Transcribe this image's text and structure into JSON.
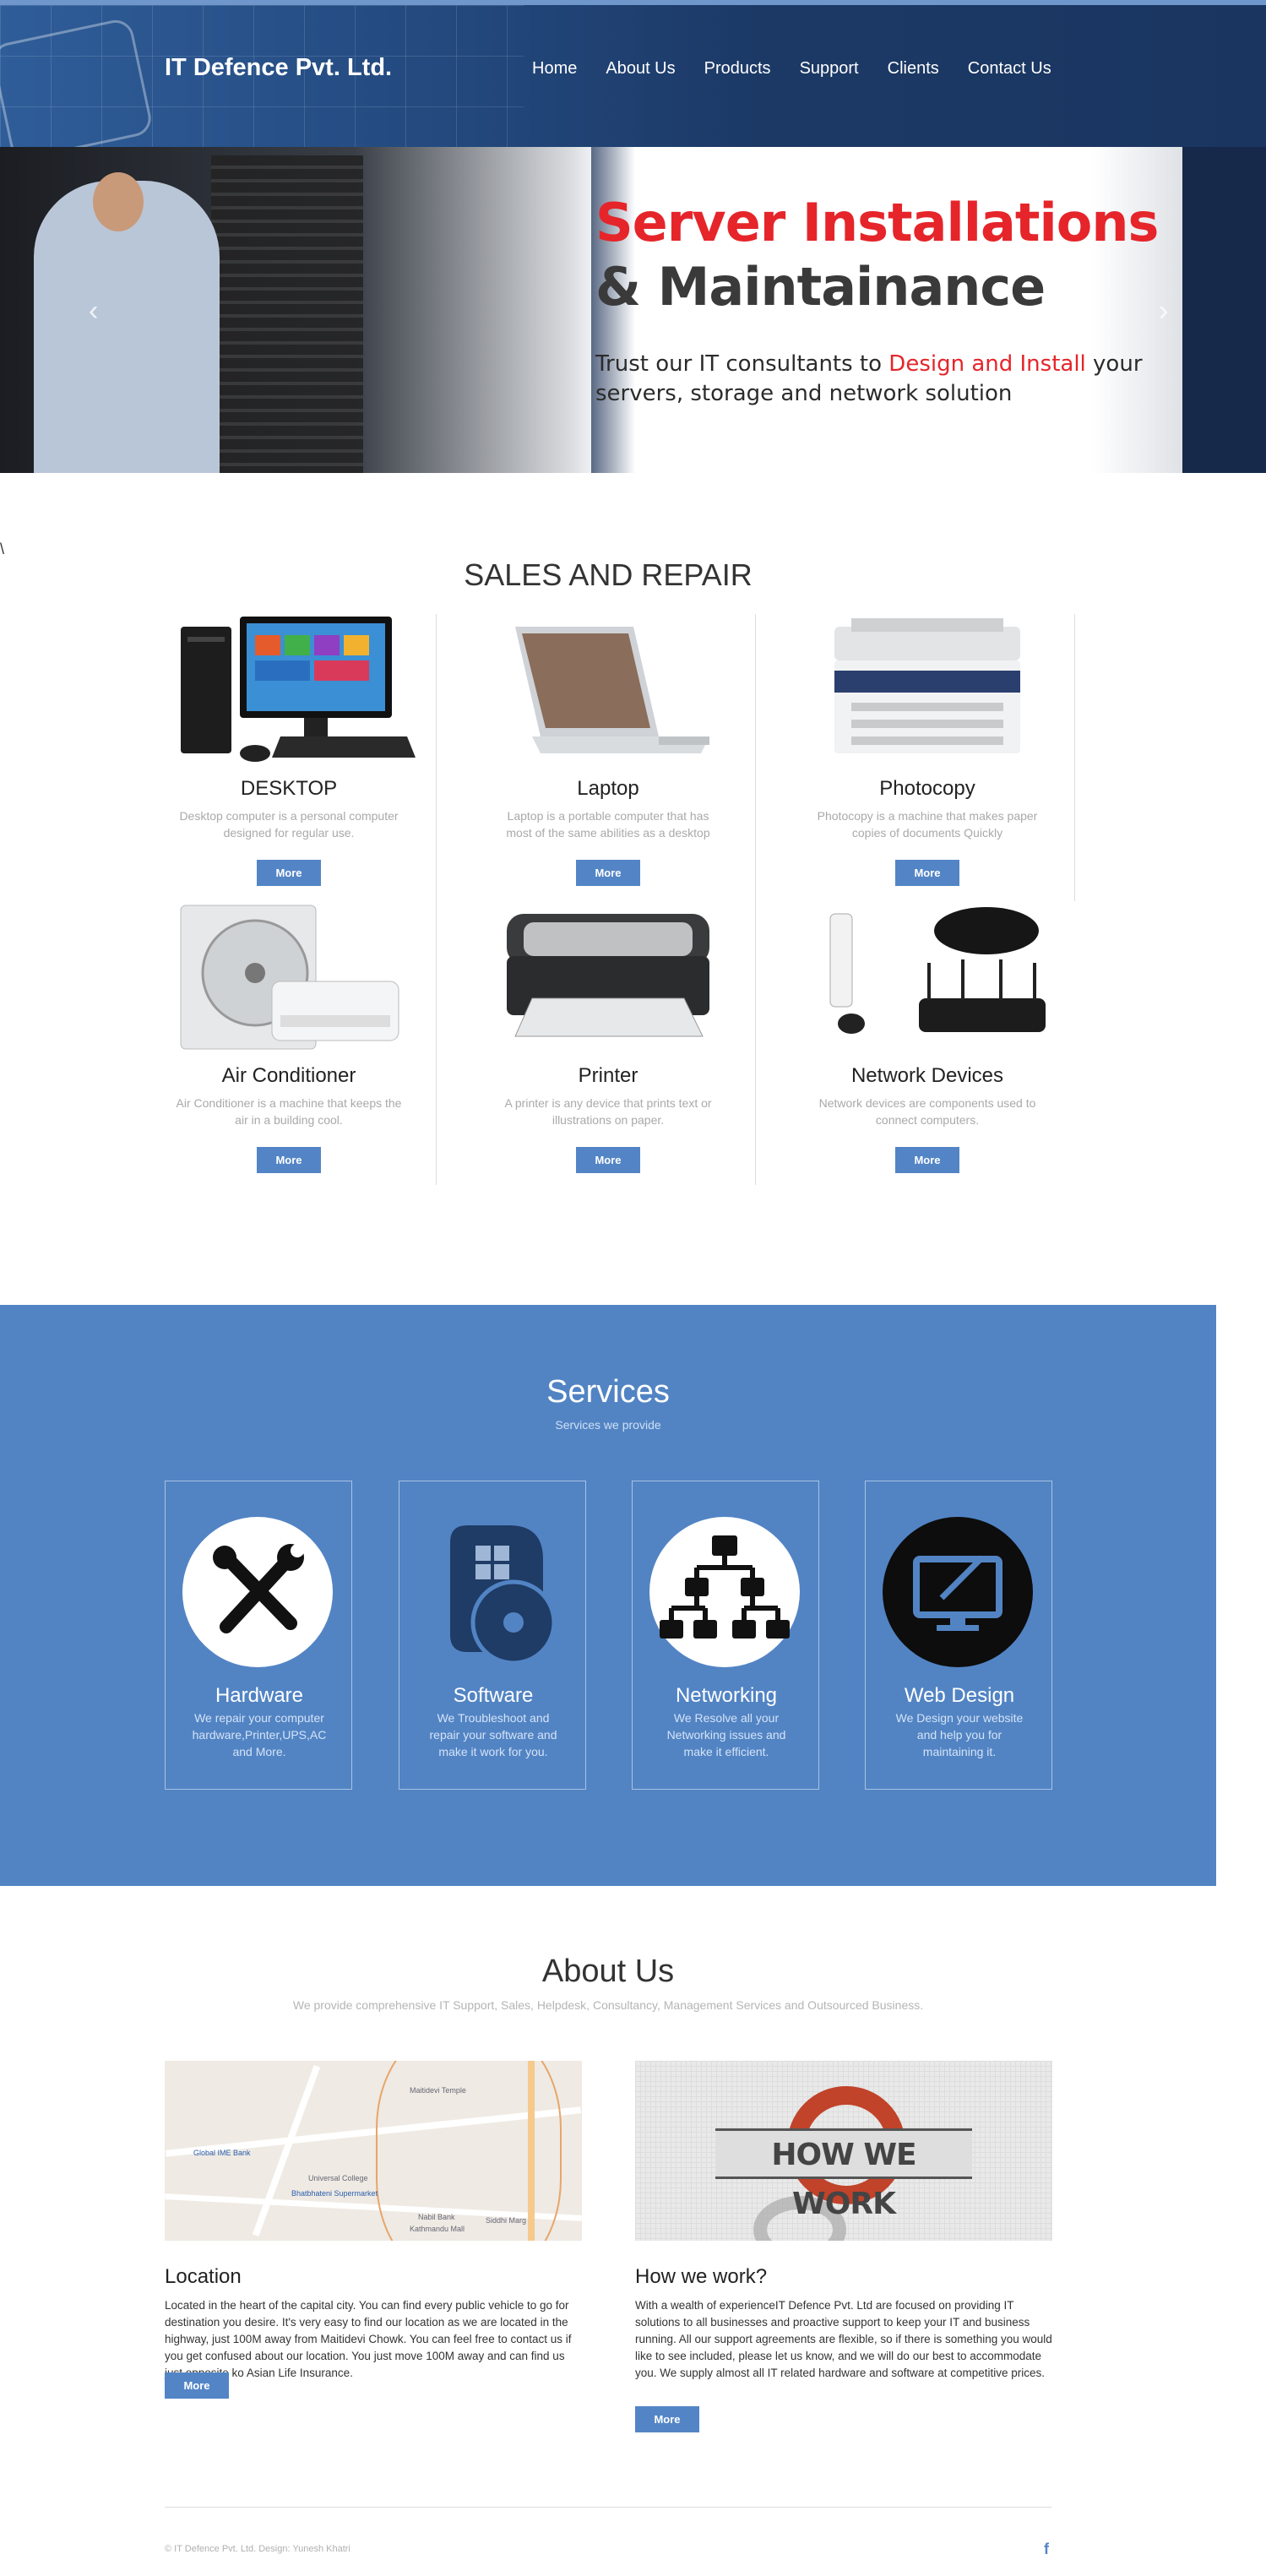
{
  "header": {
    "brand": "IT Defence Pvt. Ltd.",
    "nav": [
      "Home",
      "About Us",
      "Products",
      "Support",
      "Clients",
      "Contact Us"
    ]
  },
  "hero": {
    "title_line1": "Server Installations",
    "title_line2": "& Maintainance",
    "tag_part1": "Trust our IT consultants to ",
    "tag_highlight": "Design and Install",
    "tag_part2": " your servers, storage and network solution",
    "prev_icon": "‹",
    "next_icon": "›"
  },
  "sales": {
    "title": "SALES AND REPAIR",
    "products": [
      {
        "name": "DESKTOP",
        "desc": "Desktop computer is a personal computer designed for regular use.",
        "button": "More",
        "icon": "desktop-computer-icon"
      },
      {
        "name": "Laptop",
        "desc": "Laptop is a portable computer that has most of the same abilities as a desktop",
        "button": "More",
        "icon": "laptop-icon"
      },
      {
        "name": "Photocopy",
        "desc": "Photocopy is a machine that makes paper copies of documents Quickly",
        "button": "More",
        "icon": "photocopier-icon"
      },
      {
        "name": "Air Conditioner",
        "desc": "Air Conditioner is a machine that keeps the air in a building cool.",
        "button": "More",
        "icon": "air-conditioner-icon"
      },
      {
        "name": "Printer",
        "desc": "A printer is any device that prints text or illustrations on paper.",
        "button": "More",
        "icon": "printer-icon"
      },
      {
        "name": "Network Devices",
        "desc": "Network devices are components used to connect computers.",
        "button": "More",
        "icon": "router-icon"
      }
    ]
  },
  "services": {
    "title": "Services",
    "subtitle": "Services we provide",
    "items": [
      {
        "name": "Hardware",
        "desc": "We repair your computer hardware,Printer,UPS,AC and More.",
        "icon": "wrench-screwdriver-icon"
      },
      {
        "name": "Software",
        "desc": "We Troubleshoot and repair your software and make it work for you.",
        "icon": "software-disc-icon"
      },
      {
        "name": "Networking",
        "desc": "We Resolve all your Networking issues and make it efficient.",
        "icon": "network-hierarchy-icon"
      },
      {
        "name": "Web Design",
        "desc": "We Design your website and help you for maintaining it.",
        "icon": "web-design-monitor-icon"
      }
    ]
  },
  "about": {
    "title": "About Us",
    "subtitle": "We provide comprehensive IT Support, Sales, Helpdesk, Consultancy, Management Services and Outsourced Business.",
    "location": {
      "title": "Location",
      "text": "Located in the heart of the capital city. You can find every public vehicle to go for destination you desire. It's very easy to find our location as we are located in the highway, just 100M away from Maitidevi Chowk. You can feel free to contact us if you get confused about our location. You just move 100M away and can find us just opposite ko Asian Life Insurance.",
      "button": "More",
      "map_labels": [
        "Maitidevi Temple",
        "Global IME Bank",
        "Universal College",
        "Bhatbhateni Supermarket",
        "Nabil Bank",
        "Siddhi Marg",
        "Kathmandu Mall"
      ]
    },
    "how": {
      "title": "How we work?",
      "banner": "HOW WE WORK",
      "text": "With a wealth of experienceIT Defence Pvt. Ltd are focused on providing IT solutions to all businesses and proactive support to keep your IT and business running. All our support agreements are flexible, so if there is something you would like to see included, please let us know, and we will do our best to accommodate you. We supply almost all IT related hardware and software at competitive prices.",
      "button": "More"
    }
  },
  "footer": {
    "copyright": "© IT Defence Pvt. Ltd. Design: Yunesh Khatri",
    "social": "f"
  },
  "colors": {
    "accent": "#5385c6",
    "header": "#1d3a67",
    "hero_red": "#e5252a"
  }
}
